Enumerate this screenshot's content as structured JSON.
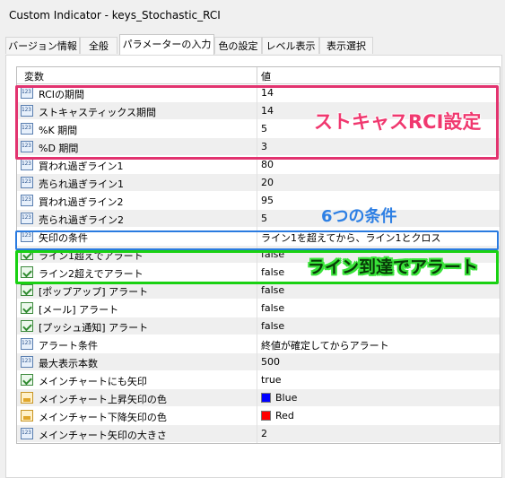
{
  "window": {
    "title": "Custom Indicator - keys_Stochastic_RCI"
  },
  "tabs": [
    {
      "label": "バージョン情報"
    },
    {
      "label": "全般"
    },
    {
      "label": "パラメーターの入力"
    },
    {
      "label": "色の設定"
    },
    {
      "label": "レベル表示"
    },
    {
      "label": "表示選択"
    }
  ],
  "grid": {
    "col_variable": "変数",
    "col_value": "値",
    "rows": [
      {
        "icon": "number-icon",
        "name": "RCIの期間",
        "value": "14"
      },
      {
        "icon": "number-icon",
        "name": "ストキャスティックス期間",
        "value": "14"
      },
      {
        "icon": "number-icon",
        "name": "%K 期間",
        "value": "5"
      },
      {
        "icon": "number-icon",
        "name": "%D 期間",
        "value": "3"
      },
      {
        "icon": "number-icon",
        "name": "買われ過ぎライン1",
        "value": "80"
      },
      {
        "icon": "number-icon",
        "name": "売られ過ぎライン1",
        "value": "20"
      },
      {
        "icon": "number-icon",
        "name": "買われ過ぎライン2",
        "value": "95"
      },
      {
        "icon": "number-icon",
        "name": "売られ過ぎライン2",
        "value": "5"
      },
      {
        "icon": "number-icon",
        "name": "矢印の条件",
        "value": "ライン1を超えてから、ライン1とクロス"
      },
      {
        "icon": "bool-icon",
        "name": "ライン1超えでアラート",
        "value": "false"
      },
      {
        "icon": "bool-icon",
        "name": "ライン2超えでアラート",
        "value": "false"
      },
      {
        "icon": "bool-icon",
        "name": "[ポップアップ] アラート",
        "value": "false"
      },
      {
        "icon": "bool-icon",
        "name": "[メール] アラート",
        "value": "false"
      },
      {
        "icon": "bool-icon",
        "name": "[プッシュ通知] アラート",
        "value": "false"
      },
      {
        "icon": "number-icon",
        "name": "アラート条件",
        "value": "終値が確定してからアラート"
      },
      {
        "icon": "number-icon",
        "name": "最大表示本数",
        "value": "500"
      },
      {
        "icon": "bool-icon",
        "name": "メインチャートにも矢印",
        "value": "true"
      },
      {
        "icon": "color-icon",
        "name": "メインチャート上昇矢印の色",
        "value": "Blue",
        "swatch": "#0000ff"
      },
      {
        "icon": "color-icon",
        "name": "メインチャート下降矢印の色",
        "value": "Red",
        "swatch": "#ff0000"
      },
      {
        "icon": "number-icon",
        "name": "メインチャート矢印の大きさ",
        "value": "2"
      }
    ]
  },
  "annotations": {
    "pink": "ストキャスRCI設定",
    "blue": "6つの条件",
    "green": "ライン到達でアラート"
  },
  "colors": {
    "pink": "#e2336f",
    "blue": "#2a7be0",
    "green": "#19d112"
  }
}
